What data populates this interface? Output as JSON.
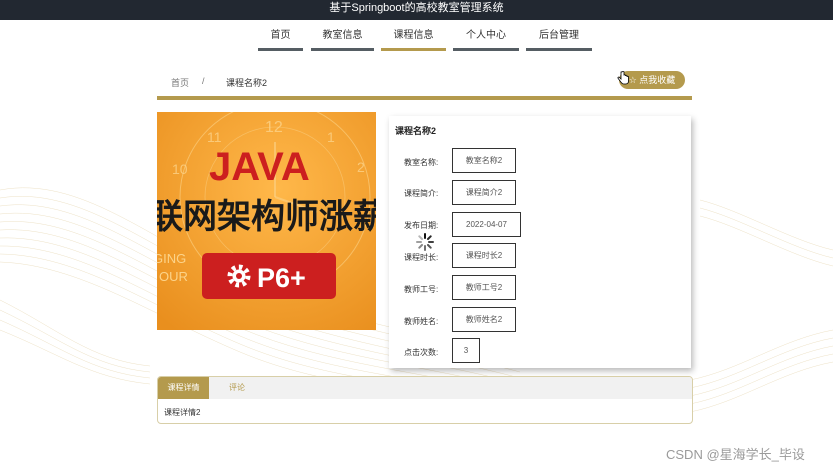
{
  "app": {
    "title": "基于Springboot的高校教室管理系统"
  },
  "nav": {
    "items": [
      {
        "label": "首页"
      },
      {
        "label": "教室信息"
      },
      {
        "label": "课程信息"
      },
      {
        "label": "个人中心"
      },
      {
        "label": "后台管理"
      }
    ],
    "active_index": 2
  },
  "breadcrumb": {
    "home": "首页",
    "separator": "/",
    "current": "课程名称2"
  },
  "favorite_button": {
    "label": "☆ 点我收藏"
  },
  "course_image": {
    "texts": {
      "java": "JAVA",
      "headline": "联网架构师涨薪",
      "sub": "GING",
      "sub2": "OUR",
      "badge": "P6+"
    },
    "clock_numbers": [
      "12",
      "1",
      "2",
      "11",
      "10"
    ]
  },
  "course": {
    "title": "课程名称2",
    "fields": [
      {
        "label": "教室名称:",
        "value": "教室名称2"
      },
      {
        "label": "课程简介:",
        "value": "课程简介2"
      },
      {
        "label": "发布日期:",
        "value": "2022-04-07"
      },
      {
        "label": "课程时长:",
        "value": "课程时长2"
      },
      {
        "label": "教师工号:",
        "value": "教师工号2"
      },
      {
        "label": "教师姓名:",
        "value": "教师姓名2"
      },
      {
        "label": "点击次数:",
        "value": "3"
      }
    ]
  },
  "detail_tabs": {
    "tabs": [
      {
        "label": "课程详情"
      },
      {
        "label": "评论"
      }
    ],
    "active_index": 0,
    "content": "课程详情2"
  },
  "watermark": "CSDN @星海学长_毕设",
  "colors": {
    "accent": "#b49a4d",
    "topbar": "#222831",
    "nav_underline": "#555d63",
    "image_orange": "#f0a030",
    "image_red": "#cc1f1f"
  }
}
